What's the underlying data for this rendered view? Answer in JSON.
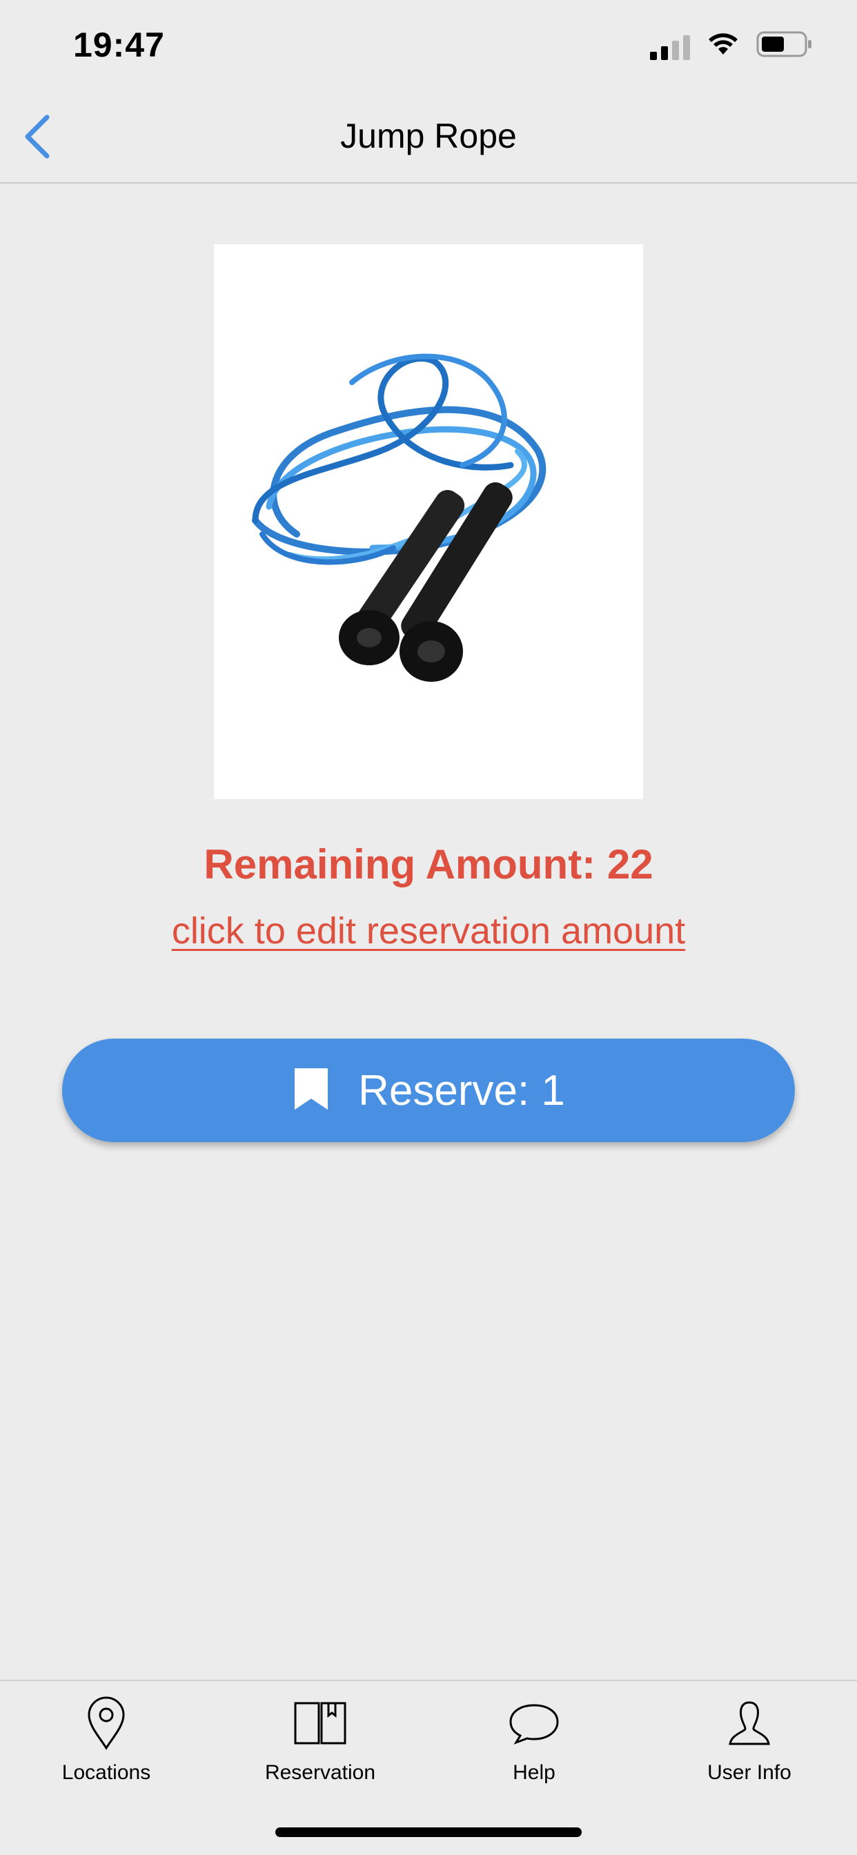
{
  "status_bar": {
    "time": "19:47"
  },
  "nav": {
    "title": "Jump Rope",
    "back_icon": "chevron-left-icon"
  },
  "product": {
    "image_alt": "jump rope with blue cord and black handles",
    "remaining_text": "Remaining Amount: 22",
    "edit_link_text": "click to edit reservation amount"
  },
  "reserve": {
    "label": "Reserve: 1",
    "icon": "bookmark-icon"
  },
  "tabs": [
    {
      "label": "Locations",
      "icon": "map-pin-icon"
    },
    {
      "label": "Reservation",
      "icon": "book-icon"
    },
    {
      "label": "Help",
      "icon": "chat-bubble-icon"
    },
    {
      "label": "User Info",
      "icon": "user-icon"
    }
  ],
  "colors": {
    "accent": "#4a90e2",
    "alert": "#de5040",
    "background": "#ececec"
  }
}
